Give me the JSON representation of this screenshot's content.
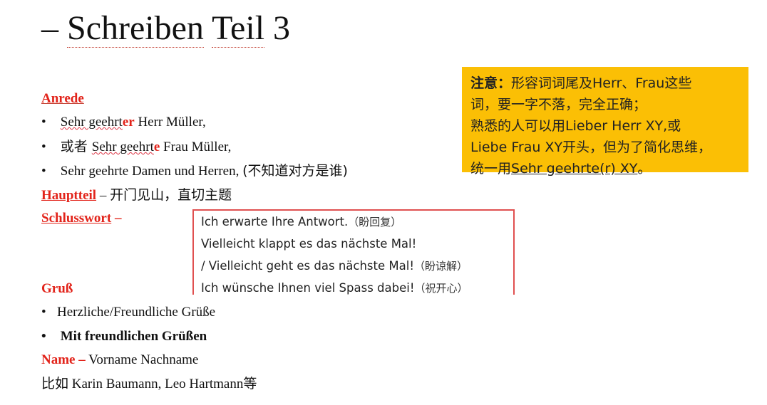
{
  "title": {
    "dash": "–",
    "word1": "Schreiben",
    "word2": "Teil",
    "num": "3"
  },
  "anrede": {
    "label": "Anrede",
    "b1": {
      "pre": "Sehr geehrt",
      "red": "er",
      "post": " Herr Müller,"
    },
    "b2": {
      "zh": "或者 ",
      "pre": "Sehr geehrt",
      "red": "e",
      "post": " Frau Müller,"
    },
    "b3": {
      "text": "Sehr geehrte Damen und Herren,",
      "zh": "(不知道对方是谁)"
    }
  },
  "hauptteil": {
    "label": "Hauptteil",
    "dash": " – ",
    "zh": "开门见山，直切主题"
  },
  "schlusswort": {
    "label": "Schlusswort",
    "dash": " –"
  },
  "gruss": {
    "label": "Gruß",
    "b1": "Herzliche/Freundliche Grüße",
    "b2": "Mit freundlichen  Grüßen"
  },
  "name": {
    "label": "Name –",
    "text": " Vorname  Nachname"
  },
  "example": {
    "zh_pre": "比如",
    "text": " Karin Baumann,  Leo Hartmann",
    "zh_post": "等"
  },
  "note": {
    "bold": "注意：",
    "l1": "形容词词尾及Herr、Frau这些",
    "l2": "词，要一字不落，完全正确；",
    "l3": "熟悉的人可以用Lieber Herr XY,或",
    "l4": "Liebe Frau XY开头，但为了简化思维，",
    "l5_pre": "统一用",
    "l5_ul": "Sehr geehrte(r) XY",
    "l5_post": "。"
  },
  "phrases": [
    {
      "de": "Ich erwarte Ihre Antwort.",
      "zh": "（盼回复）"
    },
    {
      "de": "Vielleicht klappt es das nächste Mal!",
      "zh": ""
    },
    {
      "de": "/ Vielleicht geht es das nächste Mal!",
      "zh": "（盼谅解）"
    },
    {
      "de": "Ich wünsche Ihnen viel Spass dabei!",
      "zh": "（祝开心）"
    }
  ]
}
